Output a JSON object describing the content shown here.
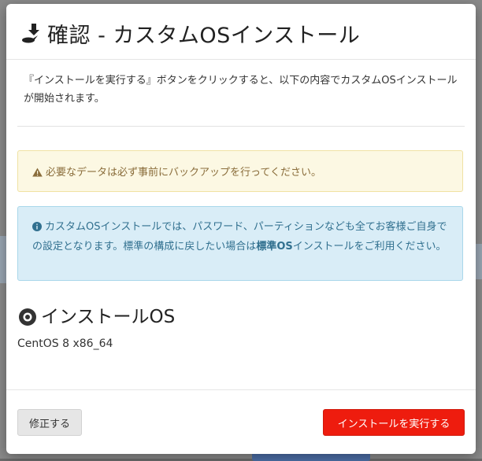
{
  "dialog": {
    "title": "確認 - カスタムOSインストール",
    "intro": "『インストールを実行する』ボタンをクリックすると、以下の内容でカスタムOSインストールが開始されます。",
    "warning": "必要なデータは必ず事前にバックアップを行ってください。",
    "info_part1": "カスタムOSインストールでは、パスワード、パーティションなども全てお客様ご自身での設定となります。標準の構成に戻したい場合は",
    "info_bold": "標準OS",
    "info_part2": "インストールをご利用ください。",
    "os_heading": "インストールOS",
    "os_name": "CentOS 8 x86_64"
  },
  "buttons": {
    "edit": "修正する",
    "run": "インストールを実行する"
  },
  "colors": {
    "run_button": "#ee1c0e",
    "warning_bg": "#fcf8e3",
    "info_bg": "#d9edf7"
  },
  "icons": {
    "title": "install-download-icon",
    "warning": "warning-icon",
    "info": "info-icon",
    "os": "disc-icon"
  }
}
